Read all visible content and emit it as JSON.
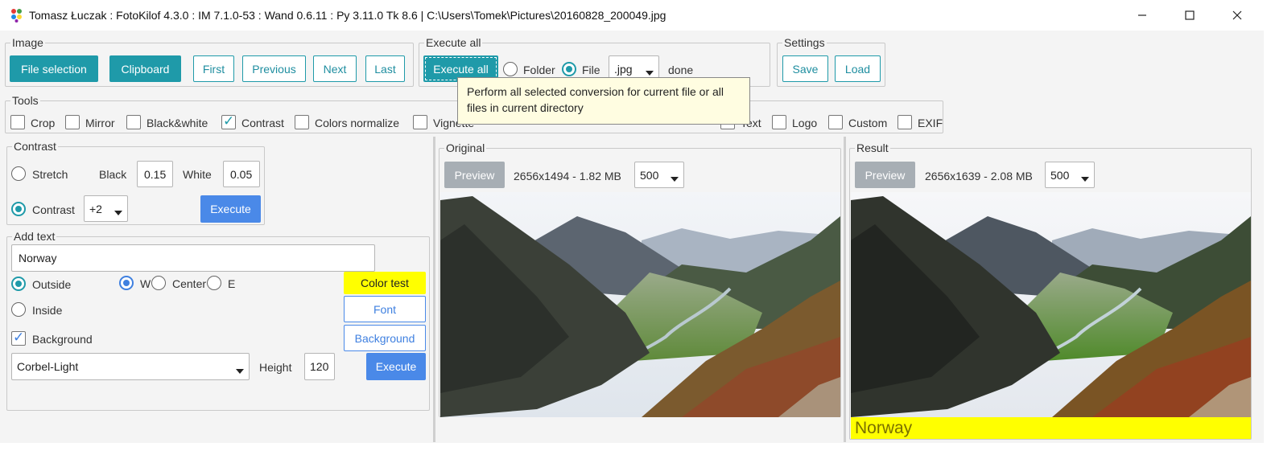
{
  "window": {
    "title": "Tomasz Łuczak : FotoKilof 4.3.0 : IM 7.1.0-53 : Wand 0.6.11 : Py 3.11.0 Tk 8.6 | C:\\Users\\Tomek\\Pictures\\20160828_200049.jpg"
  },
  "image_group": {
    "legend": "Image",
    "file_selection": "File selection",
    "clipboard": "Clipboard",
    "first": "First",
    "previous": "Previous",
    "next": "Next",
    "last": "Last"
  },
  "execute_group": {
    "legend": "Execute all",
    "execute_all": "Execute all",
    "folder": "Folder",
    "file": "File",
    "format": ".jpg",
    "status": "done",
    "tooltip": "Perform all selected conversion for current file or all files in current directory"
  },
  "settings_group": {
    "legend": "Settings",
    "save": "Save",
    "load": "Load"
  },
  "tools_group": {
    "legend": "Tools",
    "items": [
      {
        "label": "Crop",
        "checked": false
      },
      {
        "label": "Mirror",
        "checked": false
      },
      {
        "label": "Black&white",
        "checked": false
      },
      {
        "label": "Contrast",
        "checked": true
      },
      {
        "label": "Colors normalize",
        "checked": false
      },
      {
        "label": "Vignette",
        "checked": false
      },
      {
        "label": "Text",
        "checked": true
      },
      {
        "label": "Logo",
        "checked": false
      },
      {
        "label": "Custom",
        "checked": false
      },
      {
        "label": "EXIF",
        "checked": false
      }
    ]
  },
  "contrast_group": {
    "legend": "Contrast",
    "stretch": "Stretch",
    "black_label": "Black",
    "black_value": "0.15",
    "white_label": "White",
    "white_value": "0.05",
    "contrast": "Contrast",
    "contrast_value": "+2",
    "execute": "Execute"
  },
  "text_group": {
    "legend": "Add text",
    "text_value": "Norway",
    "outside": "Outside",
    "inside": "Inside",
    "pos_w": "W",
    "pos_center": "Center",
    "pos_e": "E",
    "color_test": "Color test",
    "font": "Font",
    "background_check": "Background",
    "background_button": "Background",
    "font_name": "Corbel-Light",
    "height_label": "Height",
    "height_value": "120",
    "execute": "Execute"
  },
  "original_panel": {
    "legend": "Original",
    "preview": "Preview",
    "info": "2656x1494 - 1.82 MB",
    "size": "500"
  },
  "result_panel": {
    "legend": "Result",
    "preview": "Preview",
    "info": "2656x1639 - 2.08 MB",
    "size": "500",
    "caption": "Norway"
  },
  "colors": {
    "teal": "#1f9aa9",
    "blue": "#4a89e8",
    "caption_bg": "#ffff00",
    "color_test_bg": "#ffff00"
  }
}
